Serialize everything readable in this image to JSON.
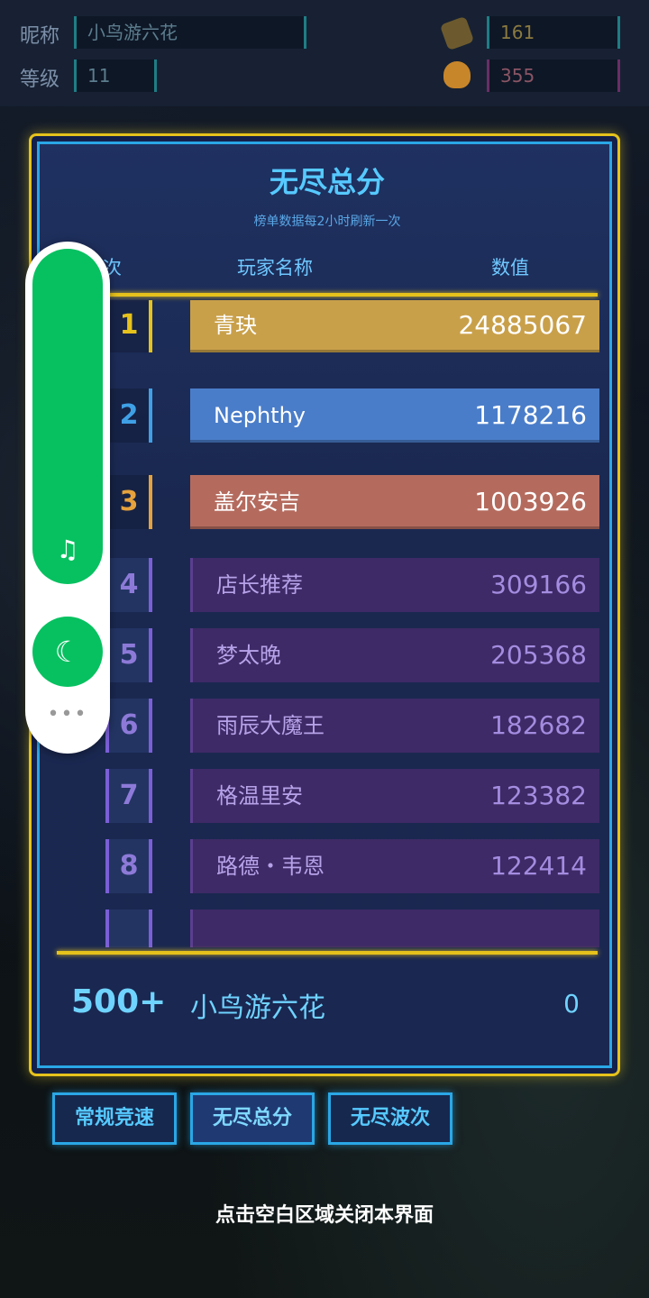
{
  "top": {
    "nickname_label": "昵称",
    "nickname_value": "小鸟游六花",
    "level_label": "等级",
    "level_value": "11",
    "stat1_value": "161",
    "stat2_value": "355"
  },
  "panel": {
    "title": "无尽总分",
    "subtitle": "榜单数据每2小时刷新一次",
    "col_rank": "名次",
    "col_player": "玩家名称",
    "col_value": "数值"
  },
  "rows": [
    {
      "rank": "1",
      "name": "青玦",
      "value": "24885067",
      "color": "#c9a04a",
      "badge": "#e6c21c"
    },
    {
      "rank": "2",
      "name": "Nephthy",
      "value": "1178216",
      "color": "#4a7dc9",
      "badge": "#3fa0e6"
    },
    {
      "rank": "3",
      "name": "盖尔安吉",
      "value": "1003926",
      "color": "#b46b5e",
      "badge": "#e6a23c"
    },
    {
      "rank": "4",
      "name": "店长推荐",
      "value": "309166"
    },
    {
      "rank": "5",
      "name": "梦太晚",
      "value": "205368"
    },
    {
      "rank": "6",
      "name": "雨辰大魔王",
      "value": "182682"
    },
    {
      "rank": "7",
      "name": "格温里安",
      "value": "123382"
    },
    {
      "rank": "8",
      "name": "路德・韦恩",
      "value": "122414"
    }
  ],
  "mine": {
    "rank": "500+",
    "name": "小鸟游六花",
    "value": "0"
  },
  "tabs": [
    {
      "label": "常规竞速"
    },
    {
      "label": "无尽总分"
    },
    {
      "label": "无尽波次"
    }
  ],
  "close_hint": "点击空白区域关闭本界面",
  "floating": {
    "music_icon": "music-note-icon",
    "moon_icon": "moon-icon",
    "more_icon": "more-dots-icon"
  }
}
